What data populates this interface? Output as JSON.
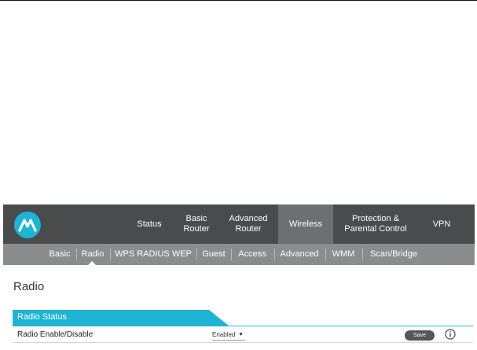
{
  "nav": {
    "items": [
      {
        "label": "Status"
      },
      {
        "label": "Basic\nRouter"
      },
      {
        "label": "Advanced\nRouter"
      },
      {
        "label": "Wireless"
      },
      {
        "label": "Protection &\nParental Control"
      },
      {
        "label": "VPN"
      }
    ],
    "active": "Wireless"
  },
  "subnav": {
    "items": [
      {
        "label": "Basic"
      },
      {
        "label": "Radio"
      },
      {
        "label": "WPS RADIUS WEP"
      },
      {
        "label": "Guest"
      },
      {
        "label": "Access"
      },
      {
        "label": "Advanced"
      },
      {
        "label": "WMM"
      },
      {
        "label": "Scan/Bridge"
      }
    ],
    "active": "Radio"
  },
  "page": {
    "title": "Radio",
    "section_title": "Radio Status",
    "row": {
      "label": "Radio Enable/Disable",
      "select_value": "Enabled",
      "save_label": "Save"
    }
  },
  "colors": {
    "topnav_bg": "#4a4b4d",
    "subnav_bg": "#8b8c8e",
    "accent": "#1eb4d6",
    "button": "#555659"
  },
  "icons": {
    "logo": "motorola-logo-icon",
    "info": "info-icon",
    "dropdown": "caret-down-icon"
  }
}
